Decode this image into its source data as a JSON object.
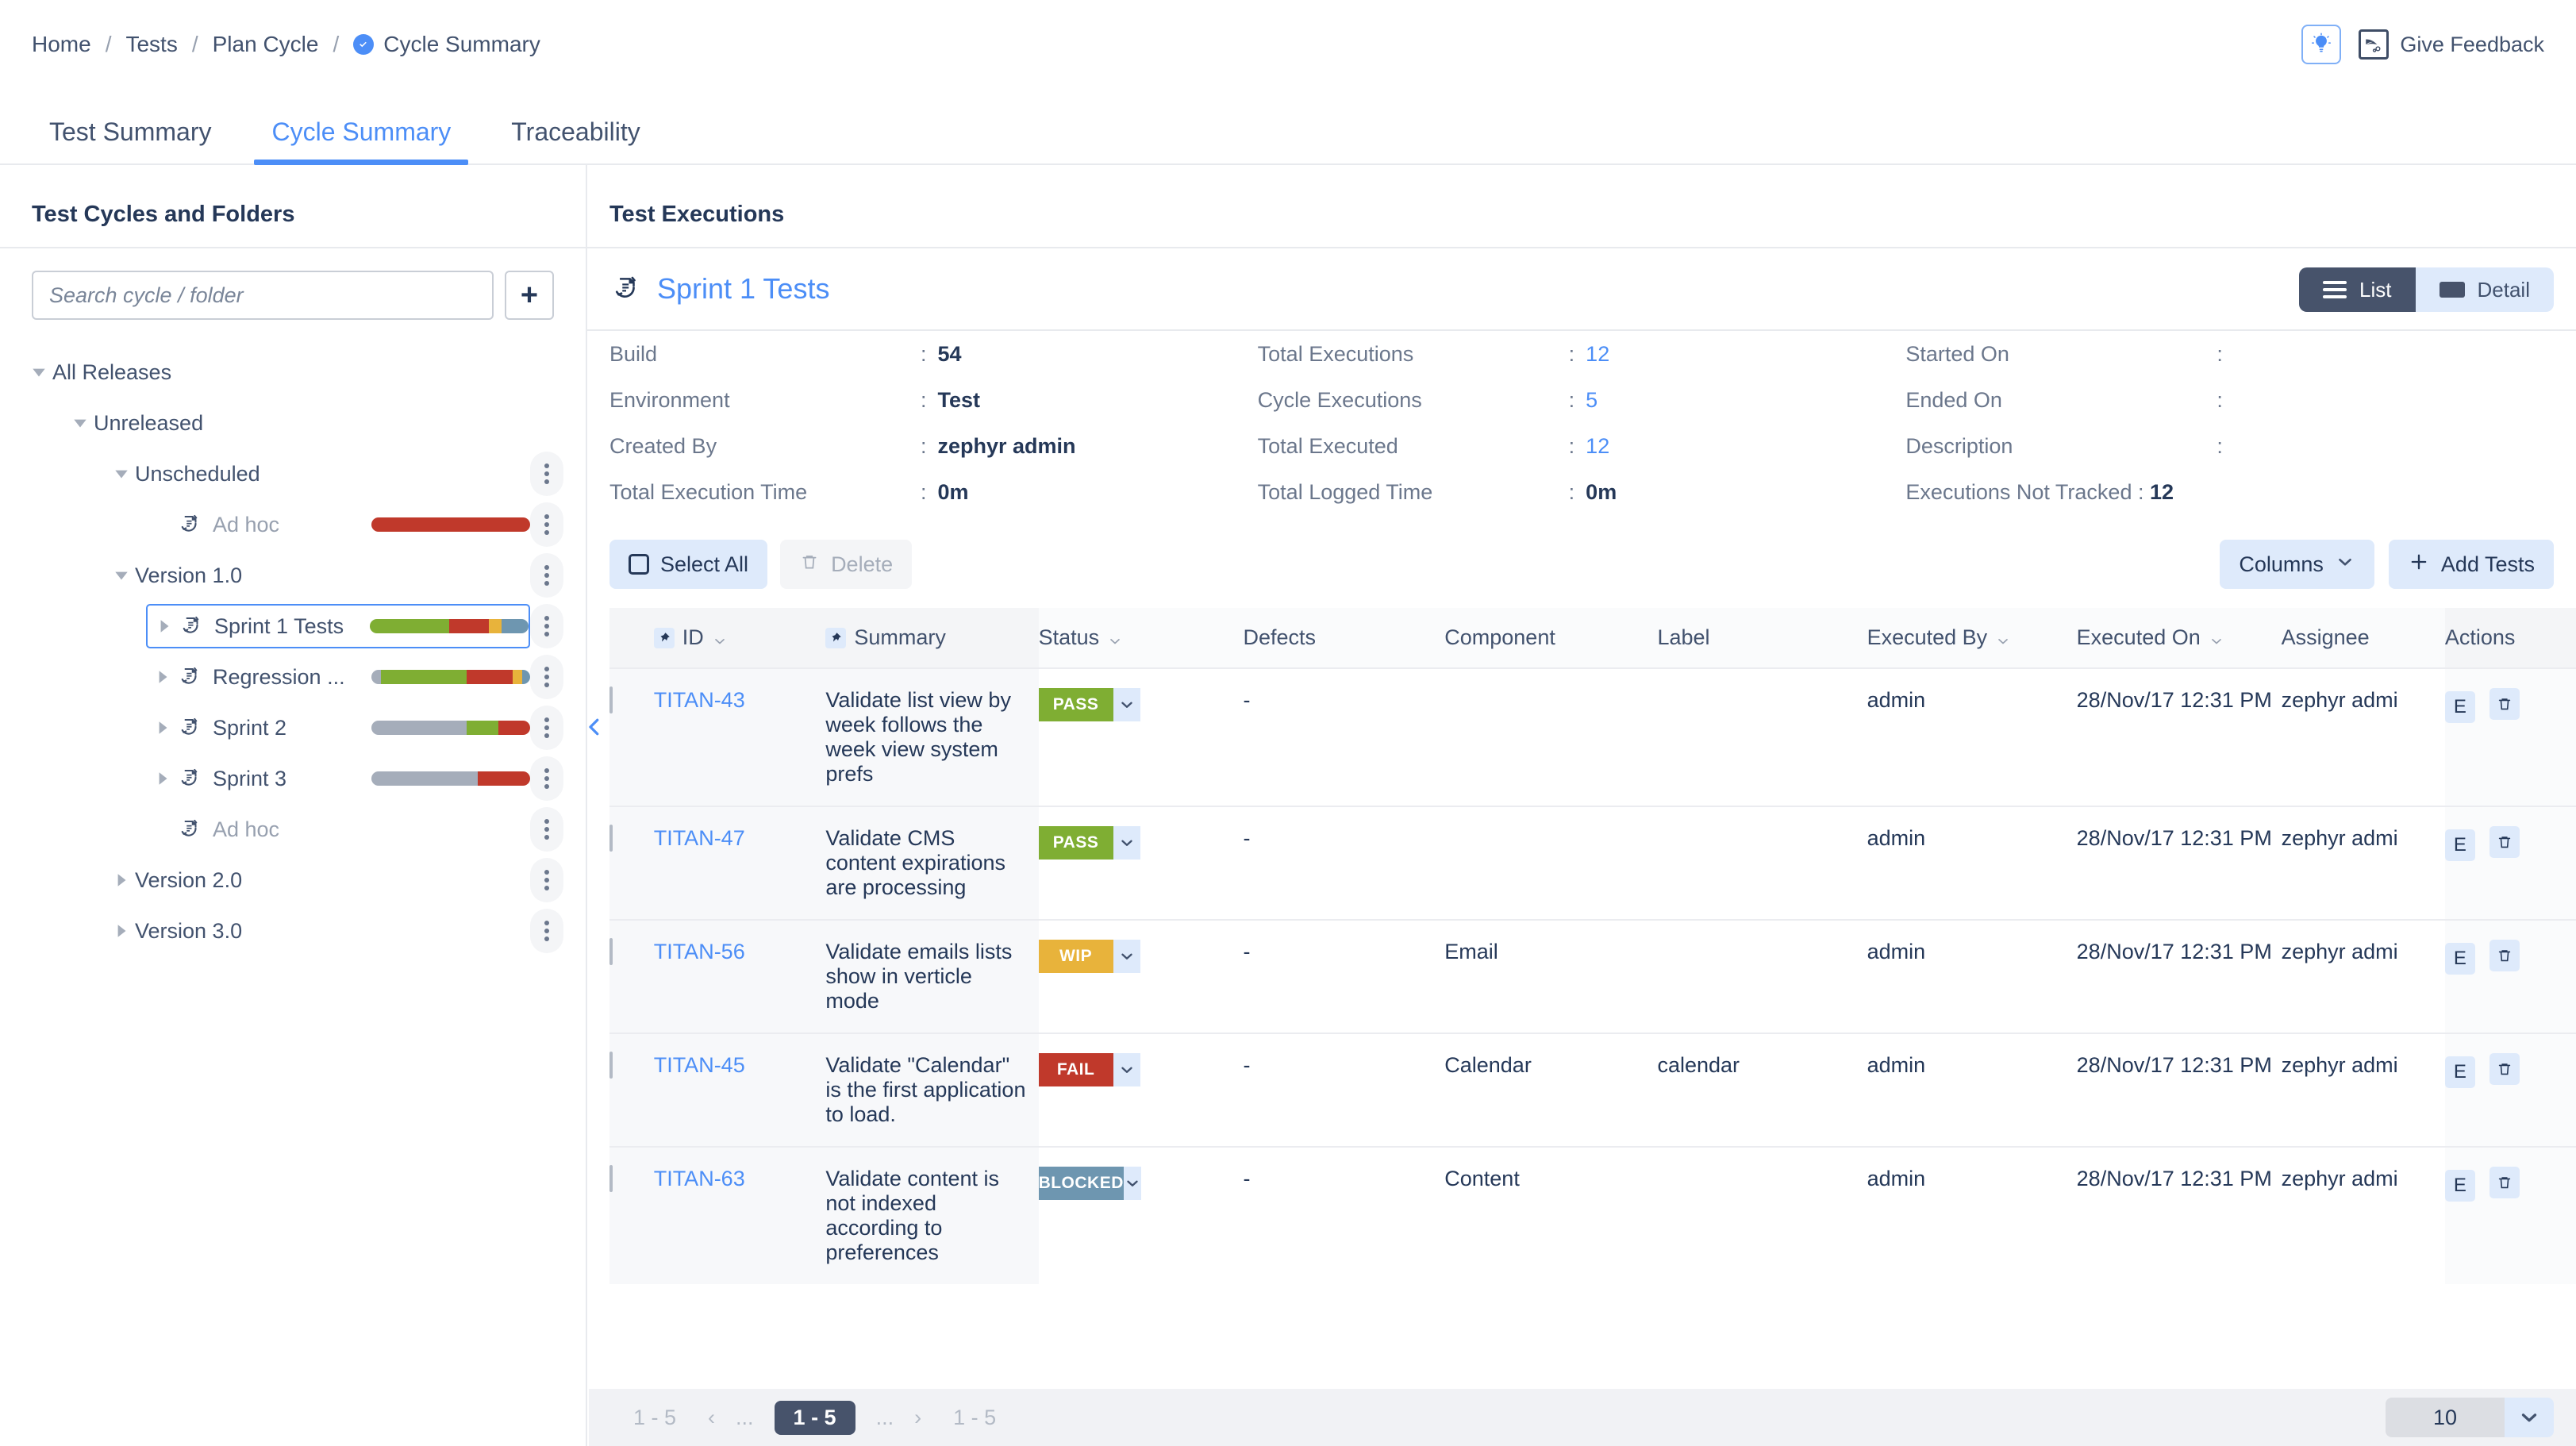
{
  "breadcrumb": {
    "items": [
      "Home",
      "Tests",
      "Plan Cycle"
    ],
    "current": "Cycle Summary",
    "separator": "/"
  },
  "topbar": {
    "bulb_icon": "lightbulb-icon",
    "feedback_icon": "feedback-icon",
    "feedback_label": "Give Feedback"
  },
  "tabs": [
    {
      "label": "Test Summary",
      "active": false
    },
    {
      "label": "Cycle Summary",
      "active": true
    },
    {
      "label": "Traceability",
      "active": false
    }
  ],
  "sidebar": {
    "title": "Test Cycles and Folders",
    "search_placeholder": "Search cycle / folder",
    "add_button": "+",
    "tree": [
      {
        "label": "All Releases",
        "depth": 0,
        "caret": "down",
        "icon": null,
        "bar": null,
        "kebab": false,
        "selected": false,
        "muted": false
      },
      {
        "label": "Unreleased",
        "depth": 1,
        "caret": "down",
        "icon": null,
        "bar": null,
        "kebab": false,
        "selected": false,
        "muted": false
      },
      {
        "label": "Unscheduled",
        "depth": 2,
        "caret": "down",
        "icon": null,
        "bar": null,
        "kebab": true,
        "selected": false,
        "muted": false
      },
      {
        "label": "Ad hoc",
        "depth": 3,
        "caret": "none",
        "icon": "cycle-icon",
        "bar": [
          {
            "c": "#C0392B",
            "p": 100
          }
        ],
        "kebab": true,
        "selected": false,
        "muted": true
      },
      {
        "label": "Version 1.0",
        "depth": 2,
        "caret": "down",
        "icon": null,
        "bar": null,
        "kebab": true,
        "selected": false,
        "muted": false
      },
      {
        "label": "Sprint 1 Tests",
        "depth": 3,
        "caret": "right",
        "icon": "cycle-icon",
        "bar": [
          {
            "c": "#7FAE33",
            "p": 50
          },
          {
            "c": "#C0392B",
            "p": 25
          },
          {
            "c": "#E8B33B",
            "p": 8
          },
          {
            "c": "#6E96B0",
            "p": 17
          }
        ],
        "kebab": true,
        "selected": true,
        "muted": false
      },
      {
        "label": "Regression ...",
        "depth": 3,
        "caret": "right",
        "icon": "cycle-icon",
        "bar": [
          {
            "c": "#A5ADBA",
            "p": 6
          },
          {
            "c": "#7FAE33",
            "p": 54
          },
          {
            "c": "#C0392B",
            "p": 29
          },
          {
            "c": "#E8B33B",
            "p": 6
          },
          {
            "c": "#6E96B0",
            "p": 5
          }
        ],
        "kebab": true,
        "selected": false,
        "muted": false
      },
      {
        "label": "Sprint 2",
        "depth": 3,
        "caret": "right",
        "icon": "cycle-icon",
        "bar": [
          {
            "c": "#A5ADBA",
            "p": 60
          },
          {
            "c": "#7FAE33",
            "p": 20
          },
          {
            "c": "#C0392B",
            "p": 20
          }
        ],
        "kebab": true,
        "selected": false,
        "muted": false
      },
      {
        "label": "Sprint 3",
        "depth": 3,
        "caret": "right",
        "icon": "cycle-icon",
        "bar": [
          {
            "c": "#A5ADBA",
            "p": 67
          },
          {
            "c": "#C0392B",
            "p": 33
          }
        ],
        "kebab": true,
        "selected": false,
        "muted": false
      },
      {
        "label": "Ad hoc",
        "depth": 3,
        "caret": "none",
        "icon": "cycle-icon",
        "bar": null,
        "kebab": true,
        "selected": false,
        "muted": true
      },
      {
        "label": "Version 2.0",
        "depth": 2,
        "caret": "right",
        "icon": null,
        "bar": null,
        "kebab": true,
        "selected": false,
        "muted": false
      },
      {
        "label": "Version 3.0",
        "depth": 2,
        "caret": "right",
        "icon": null,
        "bar": null,
        "kebab": true,
        "selected": false,
        "muted": false
      }
    ]
  },
  "executions": {
    "panel_title": "Test Executions",
    "cycle_name": "Sprint 1 Tests",
    "view_toggle": [
      {
        "label": "List",
        "active": true,
        "icon": "list-icon"
      },
      {
        "label": "Detail",
        "active": false,
        "icon": "detail-icon"
      }
    ],
    "meta": {
      "col1": [
        {
          "key": "Build",
          "value": "54",
          "link": false,
          "bold": true
        },
        {
          "key": "Environment",
          "value": "Test",
          "link": false,
          "bold": true
        },
        {
          "key": "Created By",
          "value": "zephyr admin",
          "link": false,
          "bold": true
        },
        {
          "key": "Total Execution Time",
          "value": "0m",
          "link": false,
          "bold": true
        }
      ],
      "col2": [
        {
          "key": "Total Executions",
          "value": "12",
          "link": true,
          "bold": false
        },
        {
          "key": "Cycle Executions",
          "value": "5",
          "link": true,
          "bold": false
        },
        {
          "key": "Total Executed",
          "value": "12",
          "link": true,
          "bold": false
        },
        {
          "key": "Total Logged Time",
          "value": "0m",
          "link": false,
          "bold": true
        }
      ],
      "col3": [
        {
          "key": "Started On",
          "value": "",
          "link": false,
          "bold": false
        },
        {
          "key": "Ended On",
          "value": "",
          "link": false,
          "bold": false
        },
        {
          "key": "Description",
          "value": "",
          "link": false,
          "bold": false
        }
      ],
      "not_tracked_label": "Executions Not Tracked :",
      "not_tracked_value": "12"
    },
    "toolbar": {
      "select_all": "Select All",
      "delete": "Delete",
      "columns": "Columns",
      "add_tests": "Add Tests"
    },
    "columns": [
      {
        "label": "ID",
        "pin": true,
        "sort": true
      },
      {
        "label": "Summary",
        "pin": true,
        "sort": false
      },
      {
        "label": "Status",
        "pin": false,
        "sort": true
      },
      {
        "label": "Defects",
        "pin": false,
        "sort": false
      },
      {
        "label": "Component",
        "pin": false,
        "sort": false
      },
      {
        "label": "Label",
        "pin": false,
        "sort": false
      },
      {
        "label": "Executed By",
        "pin": false,
        "sort": true
      },
      {
        "label": "Executed On",
        "pin": false,
        "sort": true
      },
      {
        "label": "Assignee",
        "pin": false,
        "sort": false
      },
      {
        "label": "Actions",
        "pin": false,
        "sort": false
      }
    ],
    "rows": [
      {
        "id": "TITAN-43",
        "summary": "Validate list view by week follows the week view system prefs",
        "status": "PASS",
        "status_color": "#7FAE33",
        "defects": "-",
        "component": "",
        "label": "",
        "executed_by": "admin",
        "executed_on": "28/Nov/17 12:31 PM",
        "assignee": "zephyr admi",
        "actions": [
          "E",
          "delete-icon"
        ],
        "checked": false
      },
      {
        "id": "TITAN-47",
        "summary": "Validate CMS content expirations are processing",
        "status": "PASS",
        "status_color": "#7FAE33",
        "defects": "-",
        "component": "",
        "label": "",
        "executed_by": "admin",
        "executed_on": "28/Nov/17 12:31 PM",
        "assignee": "zephyr admi",
        "actions": [
          "E",
          "delete-icon"
        ],
        "checked": false
      },
      {
        "id": "TITAN-56",
        "summary": "Validate emails lists show in verticle mode",
        "status": "WIP",
        "status_color": "#E8B33B",
        "defects": "-",
        "component": "Email",
        "label": "",
        "executed_by": "admin",
        "executed_on": "28/Nov/17 12:31 PM",
        "assignee": "zephyr admi",
        "actions": [
          "E",
          "delete-icon"
        ],
        "checked": false
      },
      {
        "id": "TITAN-45",
        "summary": "Validate \"Calendar\" is the first application to load.",
        "status": "FAIL",
        "status_color": "#C0392B",
        "defects": "-",
        "component": "Calendar",
        "label": "calendar",
        "executed_by": "admin",
        "executed_on": "28/Nov/17 12:31 PM",
        "assignee": "zephyr admi",
        "actions": [
          "E",
          "delete-icon"
        ],
        "checked": false
      },
      {
        "id": "TITAN-63",
        "summary": "Validate content is not indexed according to preferences",
        "status": "BLOCKED",
        "status_color": "#6E96B0",
        "defects": "-",
        "component": "Content",
        "label": "",
        "executed_by": "admin",
        "executed_on": "28/Nov/17 12:31 PM",
        "assignee": "zephyr admi",
        "actions": [
          "E",
          "delete-icon"
        ],
        "checked": false
      }
    ],
    "pagination": {
      "left_label": "1 - 5",
      "prev": "‹",
      "prev_ellipsis": "...",
      "current": "1 - 5",
      "next_ellipsis": "...",
      "next": "›",
      "right_label": "1 - 5",
      "page_size": "10"
    }
  },
  "colors": {
    "accent": "#4C8EF7",
    "pass": "#7FAE33",
    "fail": "#C0392B",
    "wip": "#E8B33B",
    "blocked": "#6E96B0",
    "unexecuted": "#A5ADBA",
    "dark": "#47536B"
  }
}
